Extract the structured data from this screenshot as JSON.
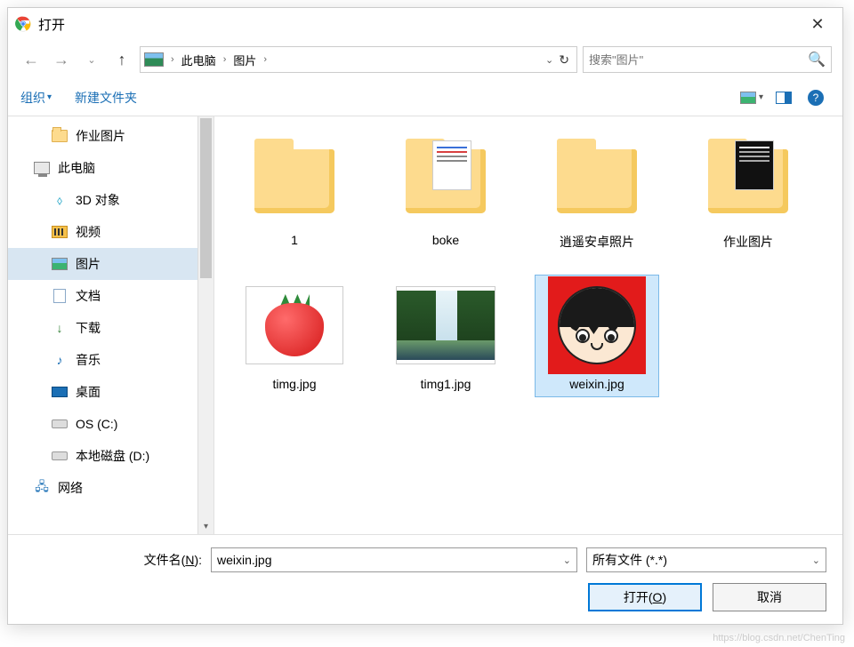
{
  "title": "打开",
  "breadcrumb": {
    "pc": "此电脑",
    "pics": "图片"
  },
  "search": {
    "placeholder": "搜索\"图片\""
  },
  "toolbar": {
    "organize": "组织",
    "newfolder": "新建文件夹"
  },
  "sidebar": {
    "homework": "作业图片",
    "thispc": "此电脑",
    "threed": "3D 对象",
    "video": "视频",
    "pictures": "图片",
    "docs": "文档",
    "downloads": "下载",
    "music": "音乐",
    "desktop": "桌面",
    "osc": "OS (C:)",
    "diskd": "本地磁盘 (D:)",
    "network": "网络"
  },
  "items": {
    "f1": "1",
    "f2": "boke",
    "f3": "逍遥安卓照片",
    "f4": "作业图片",
    "i1": "timg.jpg",
    "i2": "timg1.jpg",
    "i3": "weixin.jpg"
  },
  "footer": {
    "filename_label_pre": "文件名(",
    "filename_label_u": "N",
    "filename_label_post": "):",
    "filename_value": "weixin.jpg",
    "filter": "所有文件 (*.*)",
    "open_pre": "打开(",
    "open_u": "O",
    "open_post": ")",
    "cancel": "取消"
  },
  "watermark": "https://blog.csdn.net/ChenTing"
}
